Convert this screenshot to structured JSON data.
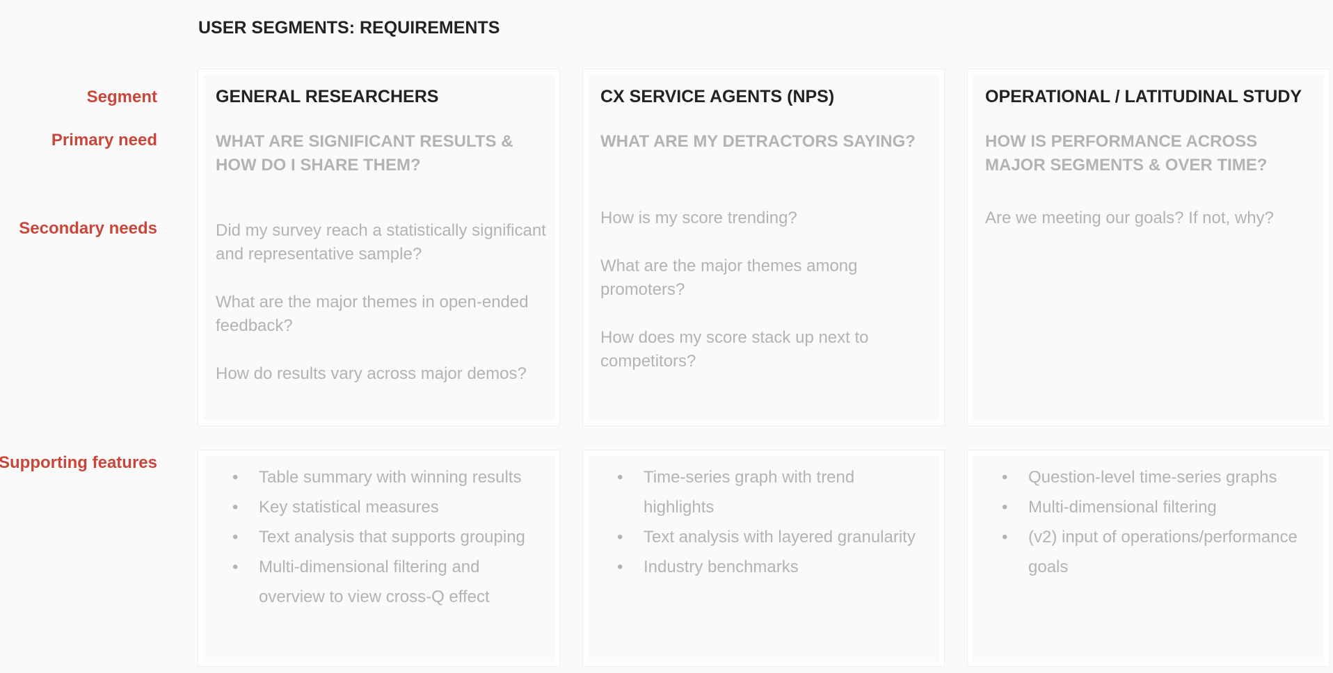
{
  "title": "USER SEGMENTS: REQUIREMENTS",
  "row_labels": {
    "segment": "Segment",
    "primary_need": "Primary need",
    "secondary_needs": "Secondary needs",
    "supporting_features": "Supporting features"
  },
  "segments": [
    {
      "name": "GENERAL RESEARCHERS",
      "primary_need": "WHAT ARE SIGNIFICANT RESULTS  & HOW  DO I SHARE THEM?",
      "secondary_needs": [
        "Did my survey reach a statistically significant and representative sample?",
        "What are the major themes in open-ended feedback?",
        "How do results vary across major demos?"
      ],
      "features": [
        "Table summary with winning results",
        "Key statistical measures",
        "Text analysis that supports grouping",
        "Multi-dimensional filtering and overview to view cross-Q effect"
      ]
    },
    {
      "name": "CX SERVICE AGENTS (NPS)",
      "primary_need": "WHAT ARE MY DETRACTORS SAYING?",
      "secondary_needs": [
        "How is my score trending?",
        "What are the major themes among promoters?",
        "How does my score stack up next to competitors?"
      ],
      "features": [
        "Time-series graph with trend highlights",
        "Text analysis with layered granularity",
        "Industry benchmarks"
      ]
    },
    {
      "name": "OPERATIONAL / LATITUDINAL STUDY",
      "primary_need": "HOW IS PERFORMANCE ACROSS MAJOR SEGMENTS & OVER TIME?",
      "secondary_needs": [
        "Are we meeting our goals? If not, why?"
      ],
      "features": [
        "Question-level time-series graphs",
        "Multi-dimensional filtering",
        "(v2) input of operations/performance goals"
      ]
    }
  ],
  "colors": {
    "label_red": "#c8463a",
    "muted_text": "#b3b3b3",
    "heading": "#222222",
    "background": "#fafafa"
  }
}
